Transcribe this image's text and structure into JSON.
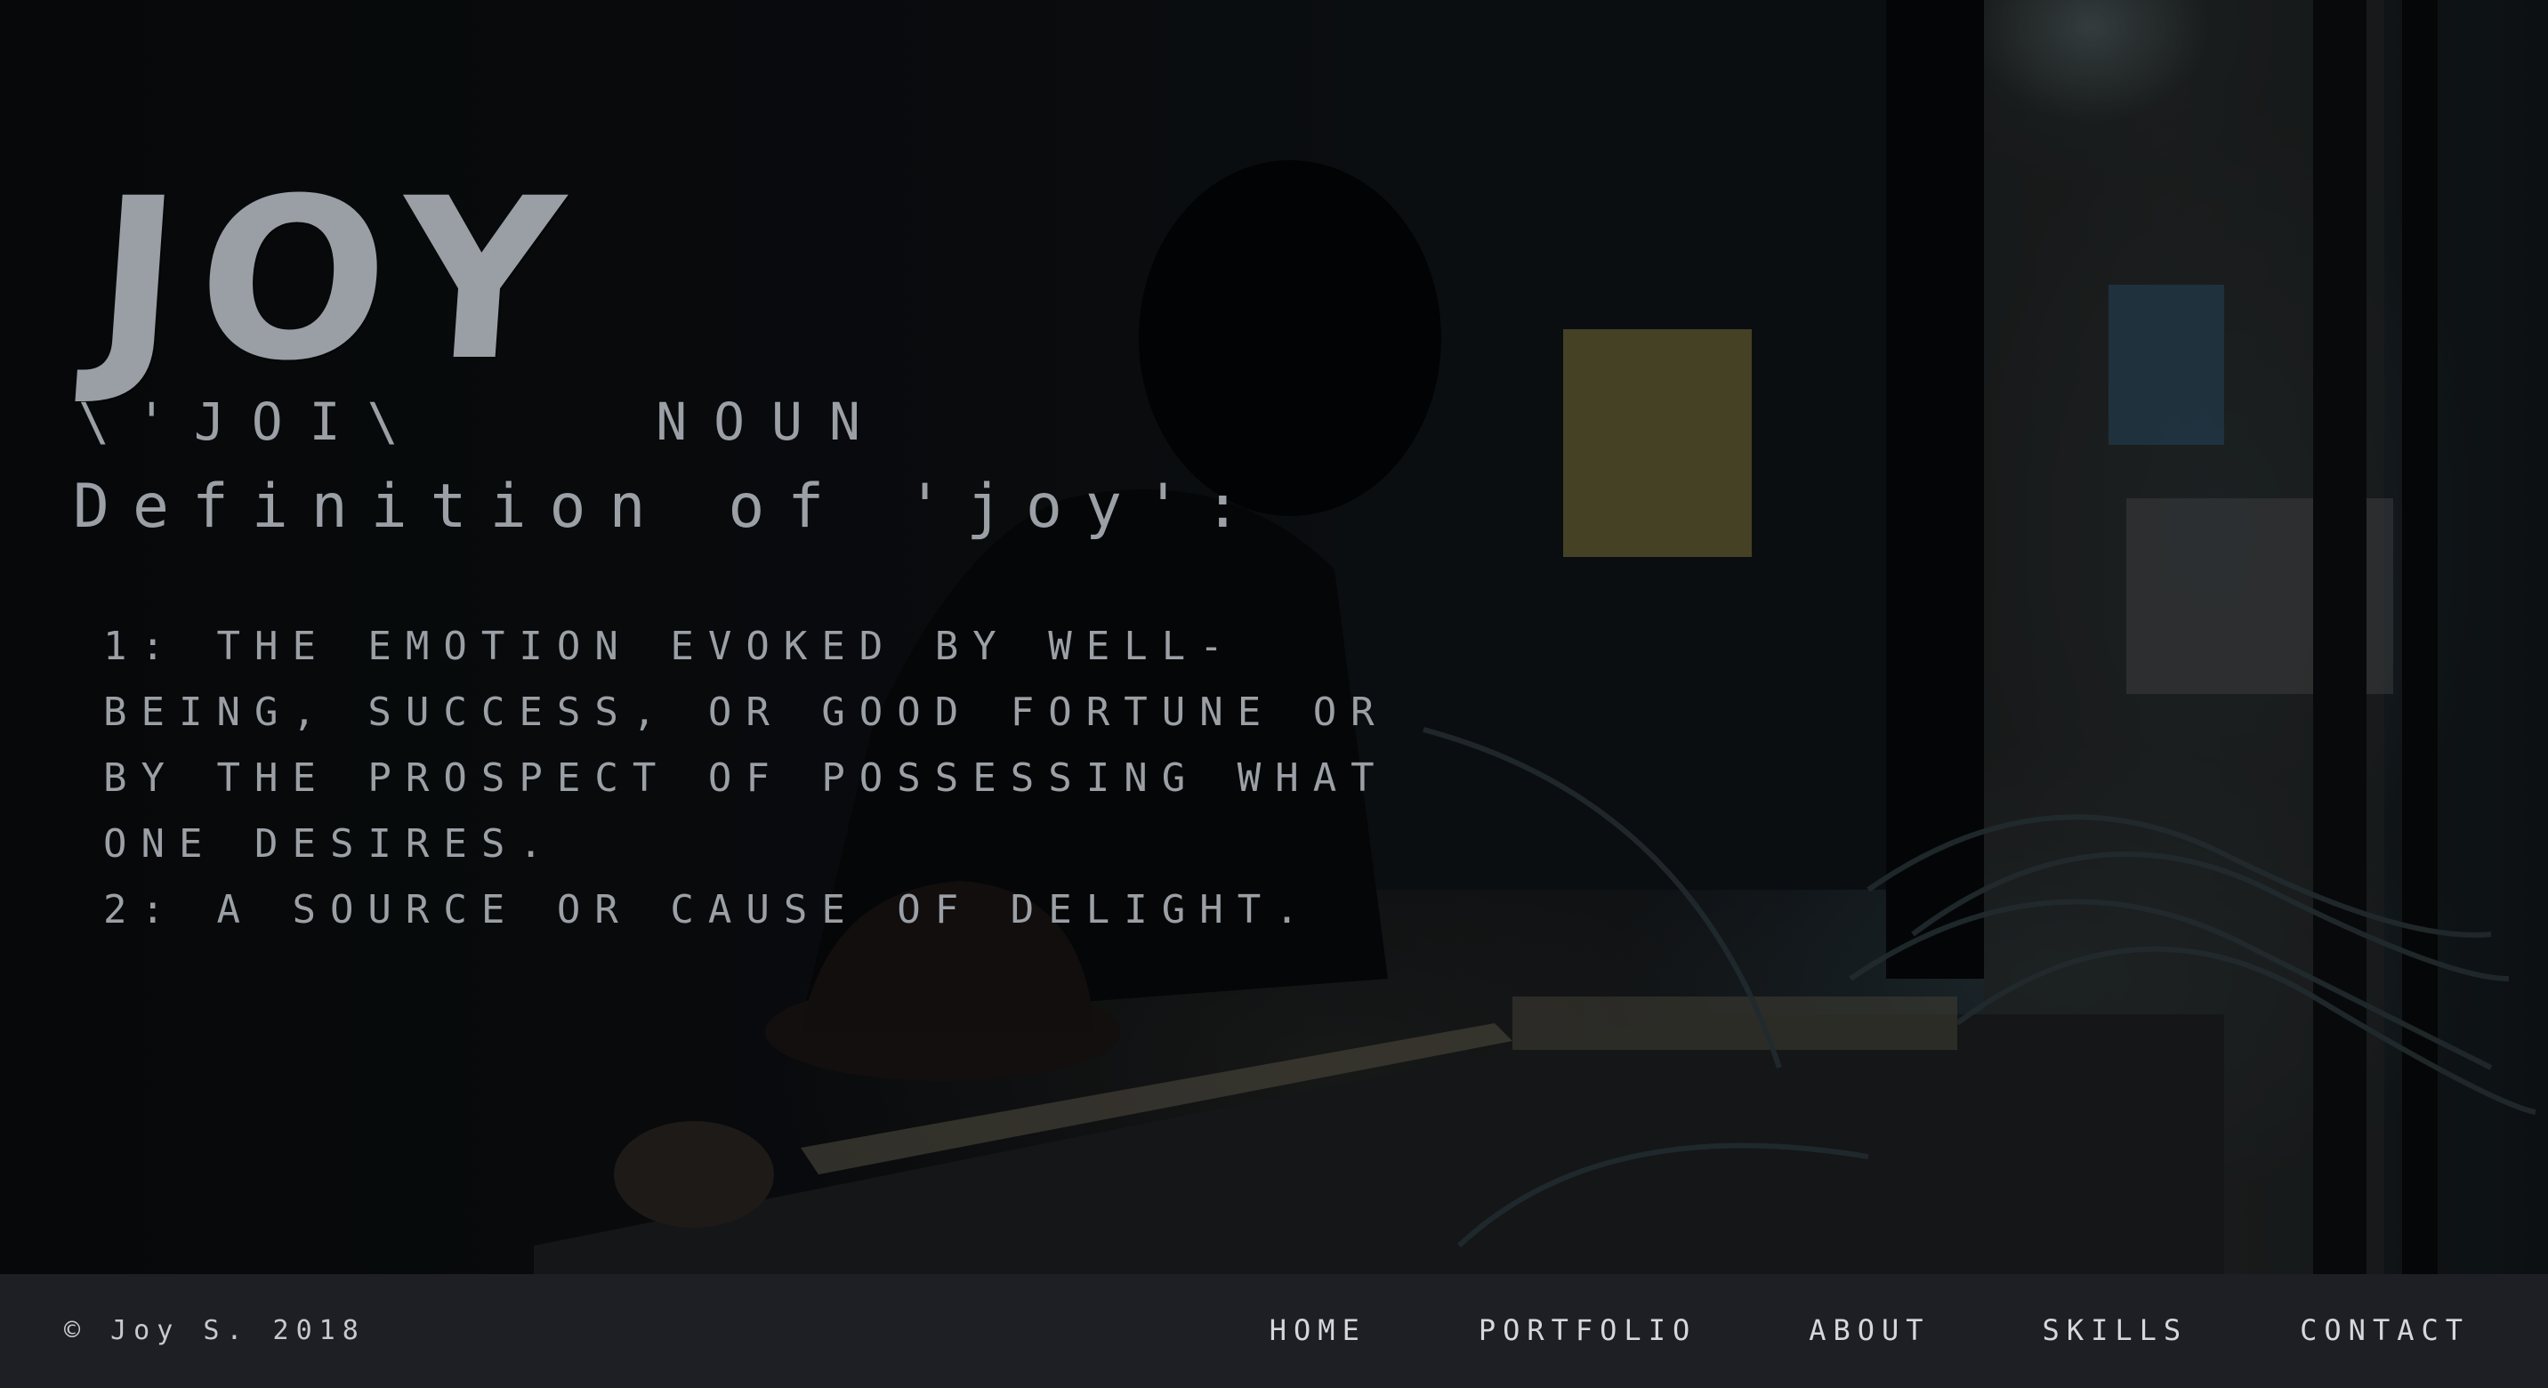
{
  "hero": {
    "title": "JOY",
    "pronunciation": "\\'JOI\\",
    "part_of_speech": "NOUN",
    "definition_heading": "Definition of 'joy':",
    "definitions": [
      "1: the emotion evoked by well-being, success, or good fortune or by the prospect of possessing what one desires.",
      "2: a source or cause of delight."
    ]
  },
  "footer": {
    "copyright": "© Joy S. 2018",
    "nav": [
      {
        "label": "Home"
      },
      {
        "label": "Portfolio"
      },
      {
        "label": "About"
      },
      {
        "label": "Skills"
      },
      {
        "label": "Contact"
      }
    ]
  },
  "colors": {
    "text": "#9ba0a6",
    "footer_bg": "#1e1f25",
    "nav_text": "#d6d7db"
  }
}
